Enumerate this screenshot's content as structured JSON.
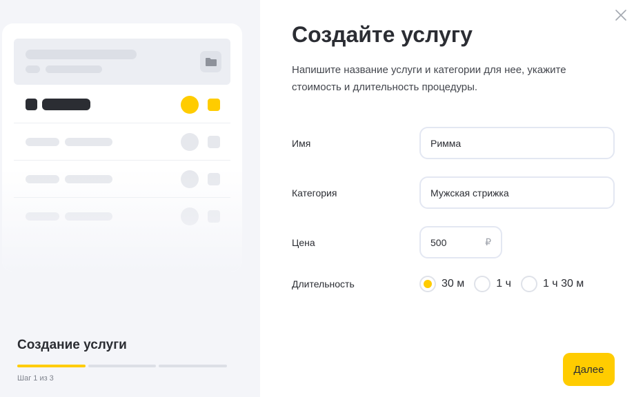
{
  "close_icon": "close-icon",
  "left": {
    "title": "Создание услуги",
    "step_text": "Шаг 1 из 3",
    "progress": {
      "current_step": 1,
      "total_steps": 3
    },
    "preview_icon": "folder-icon"
  },
  "main": {
    "title": "Создайте услугу",
    "subtitle": "Напишите название услуги и категории для нее, укажите стоимость и длительность процедуры."
  },
  "form": {
    "name": {
      "label": "Имя",
      "value": "Римма"
    },
    "category": {
      "label": "Категория",
      "value": "Мужская стрижка"
    },
    "price": {
      "label": "Цена",
      "value": "500",
      "currency": "₽"
    },
    "duration": {
      "label": "Длительность",
      "options": [
        "30 м",
        "1 ч",
        "1 ч 30 м"
      ],
      "selected": "30 м"
    }
  },
  "next_button": "Далее",
  "colors": {
    "accent": "#ffcc00",
    "text": "#2b2d33",
    "panel": "#f4f5f9"
  }
}
